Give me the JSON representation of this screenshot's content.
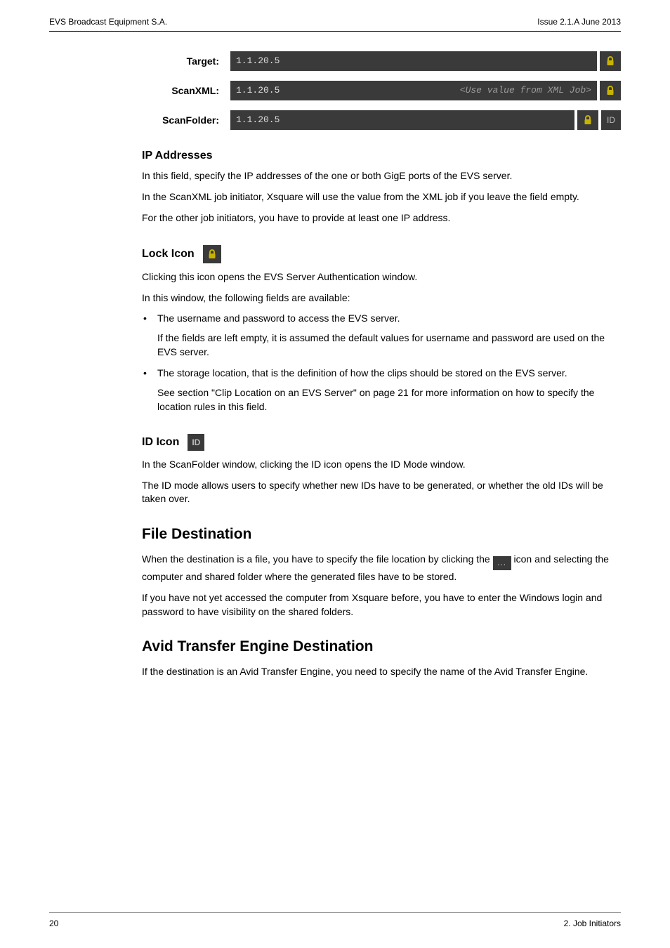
{
  "header": {
    "left": "EVS Broadcast Equipment S.A.",
    "right": "Issue 2.1.A June 2013"
  },
  "rows": {
    "target": {
      "label": "Target:",
      "value": "1.1.20.5"
    },
    "scanxml": {
      "label": "ScanXML:",
      "value": "1.1.20.5",
      "placeholder": "<Use value from XML Job>"
    },
    "scanfolder": {
      "label": "ScanFolder:",
      "value": "1.1.20.5",
      "id_label": "ID"
    }
  },
  "ip": {
    "heading": "IP Addresses",
    "p1": "In this field, specify the IP addresses of the one or both GigE ports of the EVS server.",
    "p2": "In the ScanXML job initiator, Xsquare will use the value from the XML job if you leave the field empty.",
    "p3": "For the other job initiators, you have to provide at least one IP address."
  },
  "lock": {
    "heading": "Lock Icon ",
    "p1": "Clicking this icon opens the EVS Server Authentication window.",
    "p2": "In this window, the following fields are available:",
    "b1": "The username and password to access the EVS server.",
    "b1sub": "If the fields are left empty, it is assumed the default values for username and password are used on the EVS server.",
    "b2": "The storage location, that is the definition of how the clips should be stored on the EVS server.",
    "b2sub": "See section \"Clip Location on an EVS Server\" on page 21 for more information on how to specify the location rules in this field."
  },
  "idicon": {
    "heading": "ID Icon ",
    "badge": "ID",
    "p1": "In the ScanFolder window, clicking the ID icon opens the ID Mode window.",
    "p2": "The ID mode allows users to specify whether new IDs have to be generated, or whether the old IDs will be taken over."
  },
  "filedest": {
    "heading": "File Destination",
    "p1a": "When the destination is a file, you have to specify the file location by clicking the ",
    "p1b": " icon and selecting the computer and shared folder where the generated files have to be stored.",
    "p2": "If you have not yet accessed the computer from Xsquare before, you have to enter the Windows login and password to have visibility on the shared folders."
  },
  "avid": {
    "heading": "Avid Transfer Engine Destination",
    "p1": "If the destination is an Avid Transfer Engine, you need to specify the name of the Avid Transfer Engine."
  },
  "footer": {
    "page": "20",
    "section": "2. Job Initiators"
  },
  "icons": {
    "dots": "..."
  }
}
